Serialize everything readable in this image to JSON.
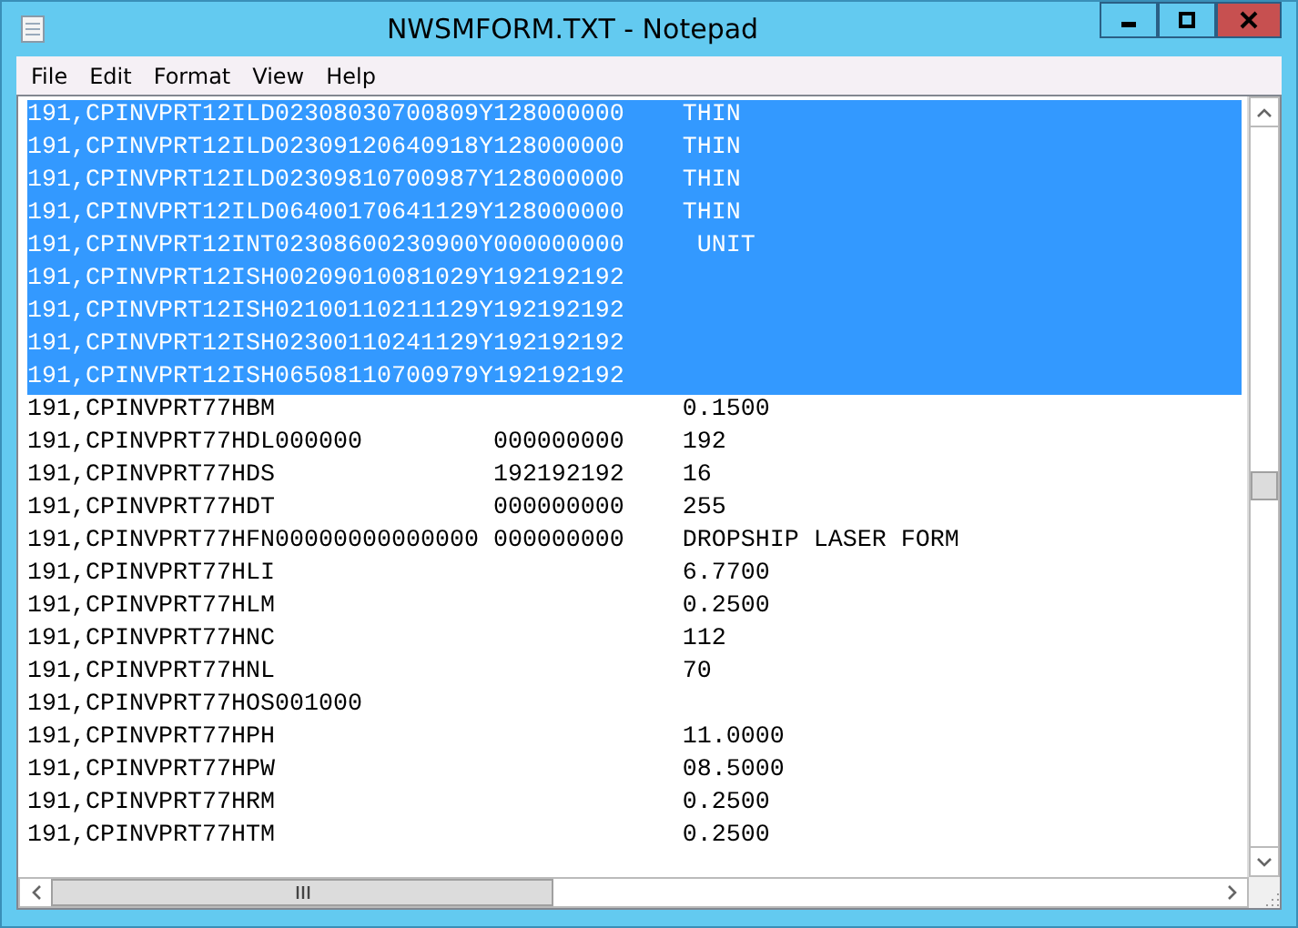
{
  "window": {
    "title": "NWSMFORM.TXT - Notepad"
  },
  "menu": [
    "File",
    "Edit",
    "Format",
    "View",
    "Help"
  ],
  "lines": [
    {
      "text": "191,CPINVPRT12ILD02308030700809Y128000000    THIN",
      "selected": true
    },
    {
      "text": "191,CPINVPRT12ILD02309120640918Y128000000    THIN",
      "selected": true
    },
    {
      "text": "191,CPINVPRT12ILD02309810700987Y128000000    THIN",
      "selected": true
    },
    {
      "text": "191,CPINVPRT12ILD06400170641129Y128000000    THIN",
      "selected": true
    },
    {
      "text": "191,CPINVPRT12INT02308600230900Y000000000     UNIT",
      "selected": true
    },
    {
      "text": "191,CPINVPRT12ISH00209010081029Y192192192",
      "selected": true
    },
    {
      "text": "191,CPINVPRT12ISH02100110211129Y192192192",
      "selected": true
    },
    {
      "text": "191,CPINVPRT12ISH02300110241129Y192192192",
      "selected": true
    },
    {
      "text": "191,CPINVPRT12ISH06508110700979Y192192192",
      "selected": true
    },
    {
      "text": "191,CPINVPRT77HBM                            0.1500",
      "selected": false
    },
    {
      "text": "191,CPINVPRT77HDL000000         000000000    192",
      "selected": false
    },
    {
      "text": "191,CPINVPRT77HDS               192192192    16",
      "selected": false
    },
    {
      "text": "191,CPINVPRT77HDT               000000000    255",
      "selected": false
    },
    {
      "text": "191,CPINVPRT77HFN00000000000000 000000000    DROPSHIP LASER FORM",
      "selected": false
    },
    {
      "text": "191,CPINVPRT77HLI                            6.7700",
      "selected": false
    },
    {
      "text": "191,CPINVPRT77HLM                            0.2500",
      "selected": false
    },
    {
      "text": "191,CPINVPRT77HNC                            112",
      "selected": false
    },
    {
      "text": "191,CPINVPRT77HNL                            70",
      "selected": false
    },
    {
      "text": "191,CPINVPRT77HOS001000",
      "selected": false
    },
    {
      "text": "191,CPINVPRT77HPH                            11.0000",
      "selected": false
    },
    {
      "text": "191,CPINVPRT77HPW                            08.5000",
      "selected": false
    },
    {
      "text": "191,CPINVPRT77HRM                            0.2500",
      "selected": false
    },
    {
      "text": "191,CPINVPRT77HTM                            0.2500",
      "selected": false
    }
  ]
}
